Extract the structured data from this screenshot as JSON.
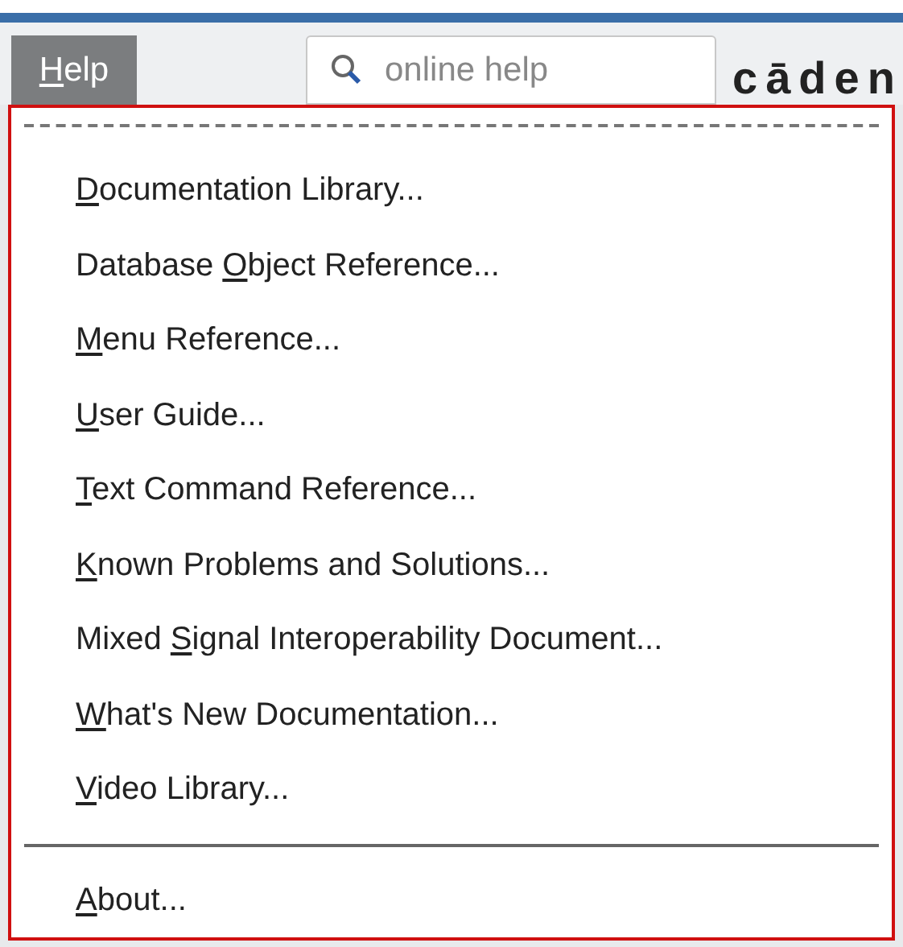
{
  "menubar": {
    "menu": {
      "key": "H",
      "after": "elp",
      "selected": true
    },
    "search": {
      "placeholder": "online help"
    },
    "logo": "cāden"
  },
  "menu": {
    "items": [
      {
        "kind": "item",
        "key": "D",
        "after": "ocumentation Library..."
      },
      {
        "kind": "item",
        "before": "Database ",
        "key": "O",
        "after": "bject Reference..."
      },
      {
        "kind": "item",
        "key": "M",
        "after": "enu Reference..."
      },
      {
        "kind": "item",
        "key": "U",
        "after": "ser Guide..."
      },
      {
        "kind": "item",
        "key": "T",
        "after": "ext Command Reference..."
      },
      {
        "kind": "item",
        "key": "K",
        "after": "nown Problems and Solutions..."
      },
      {
        "kind": "item",
        "before": "Mixed ",
        "key": "S",
        "after": "ignal Interoperability Document..."
      },
      {
        "kind": "item",
        "key": "W",
        "after": "hat's New Documentation..."
      },
      {
        "kind": "item",
        "key": "V",
        "after": "ideo Library..."
      },
      {
        "kind": "separator"
      },
      {
        "kind": "item",
        "key": "A",
        "after": "bout..."
      }
    ]
  }
}
